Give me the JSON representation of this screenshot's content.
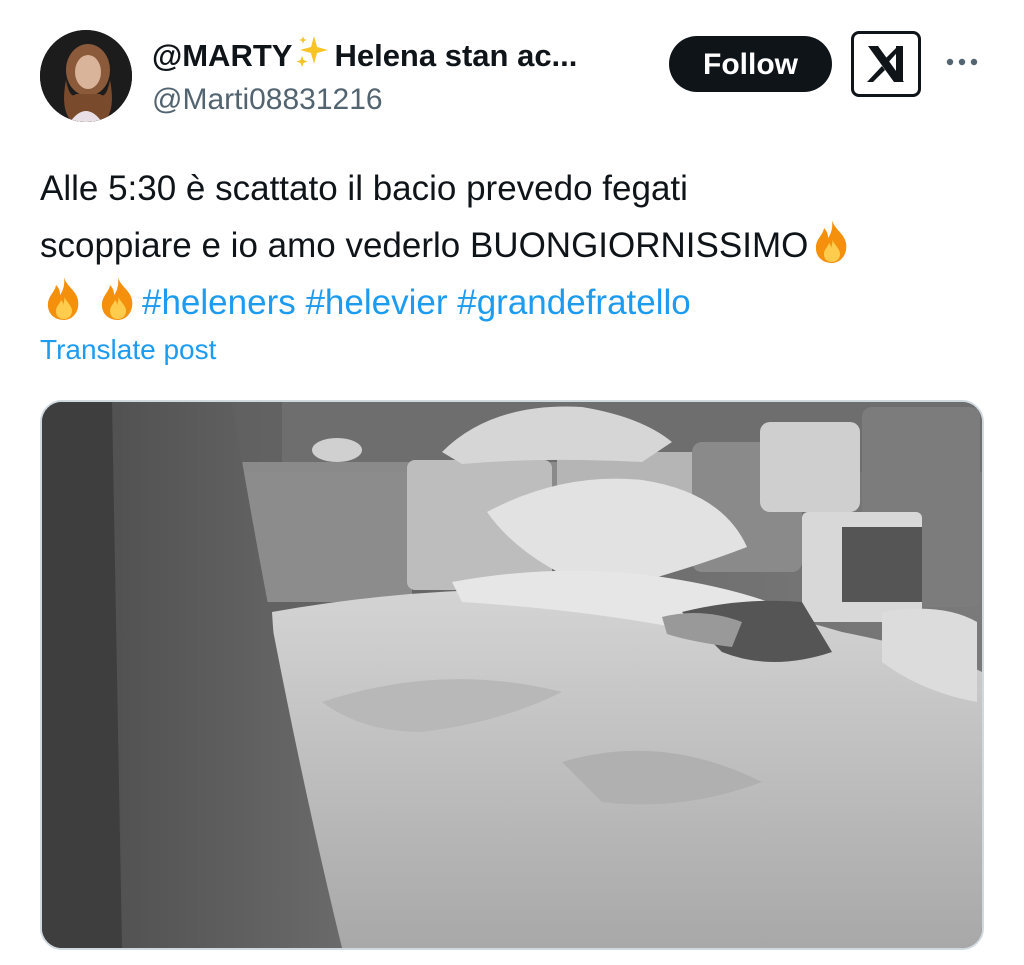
{
  "author": {
    "display_name_part1": "@MARTY",
    "display_name_part2": "Helena stan ac...",
    "handle": "@Marti08831216"
  },
  "actions": {
    "follow_label": "Follow"
  },
  "icons": {
    "sparkle": "sparkles-icon",
    "fire": "fire-icon",
    "logo": "x-logo-icon",
    "more": "more-horizontal-icon"
  },
  "tweet": {
    "line1": "Alle 5:30 è scattato il bacio prevedo fegati",
    "line2": "scoppiare e io amo vederlo BUONGIORNISSIMO",
    "hashtags": [
      "#heleners",
      "#helevier",
      "#grandefratello"
    ]
  },
  "translate_label": "Translate post",
  "colors": {
    "link": "#1d9bf0",
    "text": "#0f1419",
    "secondary": "#536471",
    "follow_bg": "#0f1419"
  }
}
